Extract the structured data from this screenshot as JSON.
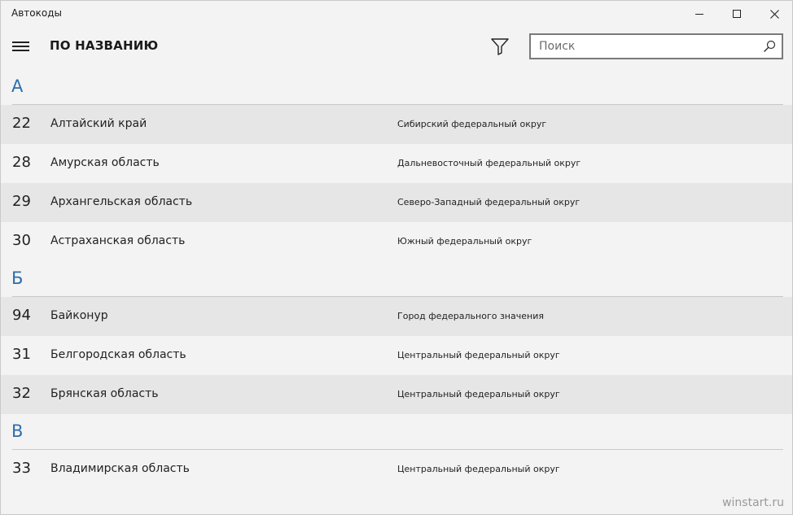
{
  "window": {
    "title": "Автокоды"
  },
  "toolbar": {
    "title": "ПО НАЗВАНИЮ",
    "search_placeholder": "Поиск"
  },
  "groups": [
    {
      "letter": "А",
      "rows": [
        {
          "code": "22",
          "name": "Алтайский край",
          "district": "Сибирский федеральный округ"
        },
        {
          "code": "28",
          "name": "Амурская область",
          "district": "Дальневосточный федеральный округ"
        },
        {
          "code": "29",
          "name": "Архангельская область",
          "district": "Северо-Западный федеральный округ"
        },
        {
          "code": "30",
          "name": "Астраханская область",
          "district": "Южный федеральный округ"
        }
      ]
    },
    {
      "letter": "Б",
      "rows": [
        {
          "code": "94",
          "name": "Байконур",
          "district": "Город федерального значения"
        },
        {
          "code": "31",
          "name": "Белгородская область",
          "district": "Центральный федеральный округ"
        },
        {
          "code": "32",
          "name": "Брянская область",
          "district": "Центральный федеральный округ"
        }
      ]
    },
    {
      "letter": "В",
      "rows": [
        {
          "code": "33",
          "name": "Владимирская область",
          "district": "Центральный федеральный округ"
        }
      ]
    }
  ],
  "watermark": "winstart.ru",
  "colors": {
    "accent": "#2d6fad",
    "row_shade": "#e6e6e6",
    "background": "#f3f3f3"
  }
}
